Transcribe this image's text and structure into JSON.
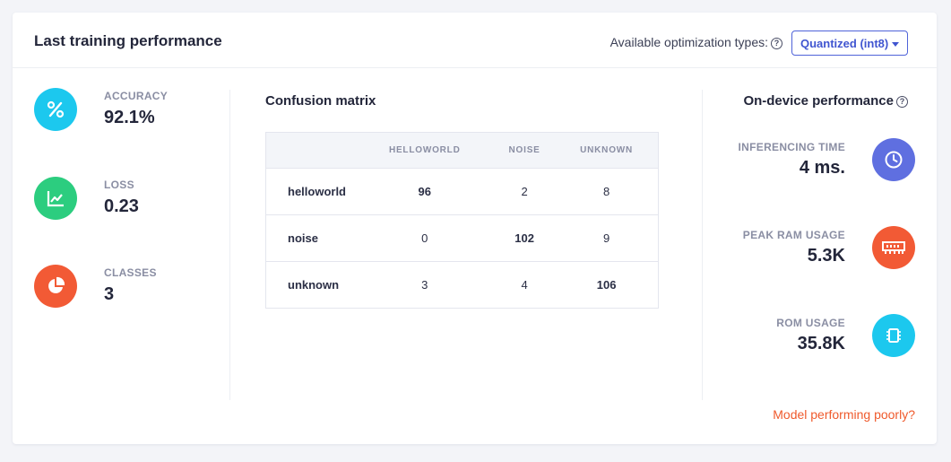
{
  "header": {
    "title": "Last training performance",
    "optimization_label": "Available optimization types:",
    "optimization_selected": "Quantized (int8)"
  },
  "metrics": [
    {
      "label": "ACCURACY",
      "value": "92.1%",
      "icon": "percent-icon",
      "color": "#1cc8ee"
    },
    {
      "label": "LOSS",
      "value": "0.23",
      "icon": "chart-line-icon",
      "color": "#2ccd7f"
    },
    {
      "label": "CLASSES",
      "value": "3",
      "icon": "pie-chart-icon",
      "color": "#f25a35"
    }
  ],
  "confusion": {
    "title": "Confusion matrix",
    "columns": [
      "HELLOWORLD",
      "NOISE",
      "UNKNOWN"
    ],
    "rows": [
      {
        "label": "helloworld",
        "values": [
          "96",
          "2",
          "8"
        ]
      },
      {
        "label": "noise",
        "values": [
          "0",
          "102",
          "9"
        ]
      },
      {
        "label": "unknown",
        "values": [
          "3",
          "4",
          "106"
        ]
      }
    ]
  },
  "device": {
    "title": "On-device performance",
    "items": [
      {
        "label": "INFERENCING TIME",
        "value": "4 ms.",
        "icon": "clock-icon",
        "color": "#5f6fe0"
      },
      {
        "label": "PEAK RAM USAGE",
        "value": "5.3K",
        "icon": "ram-icon",
        "color": "#f25a35"
      },
      {
        "label": "ROM USAGE",
        "value": "35.8K",
        "icon": "chip-icon",
        "color": "#1cc8ee"
      }
    ]
  },
  "footer": {
    "link": "Model performing poorly?"
  }
}
